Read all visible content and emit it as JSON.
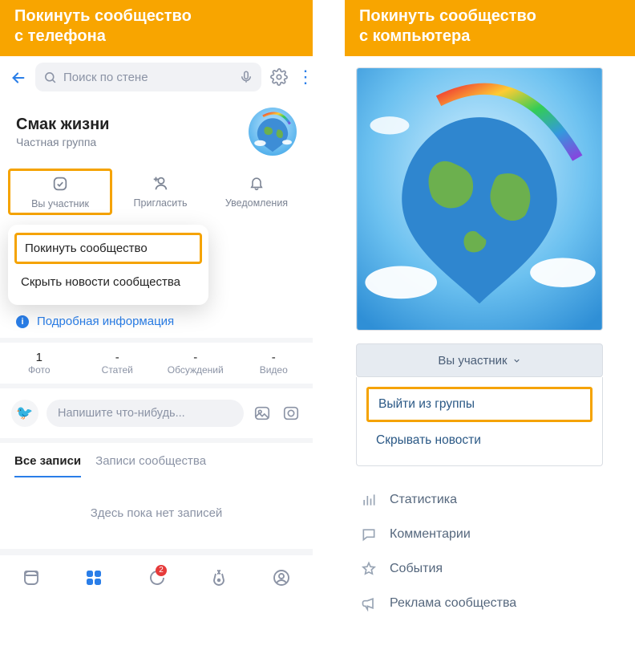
{
  "left_banner": "Покинуть сообщество\nс телефона",
  "right_banner": "Покинуть сообщество\nс компьютера",
  "mobile": {
    "search_placeholder": "Поиск по стене",
    "group_title": "Смак жизни",
    "group_sub": "Частная группа",
    "actions": {
      "member": "Вы участник",
      "invite": "Пригласить",
      "notify": "Уведомления"
    },
    "menu": {
      "leave": "Покинуть сообщество",
      "hide": "Скрыть новости сообщества"
    },
    "detail_info": "Подробная информация",
    "stats": [
      {
        "value": "1",
        "label": "Фото"
      },
      {
        "value": "-",
        "label": "Статей"
      },
      {
        "value": "-",
        "label": "Обсуждений"
      },
      {
        "value": "-",
        "label": "Видео"
      }
    ],
    "compose_placeholder": "Напишите что-нибудь...",
    "tabs": {
      "all": "Все записи",
      "community": "Записи сообщества"
    },
    "empty": "Здесь пока нет записей",
    "badge": "2"
  },
  "desktop": {
    "member_button": "Вы участник",
    "menu": {
      "leave": "Выйти из группы",
      "hide": "Скрывать новости"
    },
    "links": {
      "stats": "Статистика",
      "comments": "Комментарии",
      "events": "События",
      "ads": "Реклама сообщества"
    }
  }
}
